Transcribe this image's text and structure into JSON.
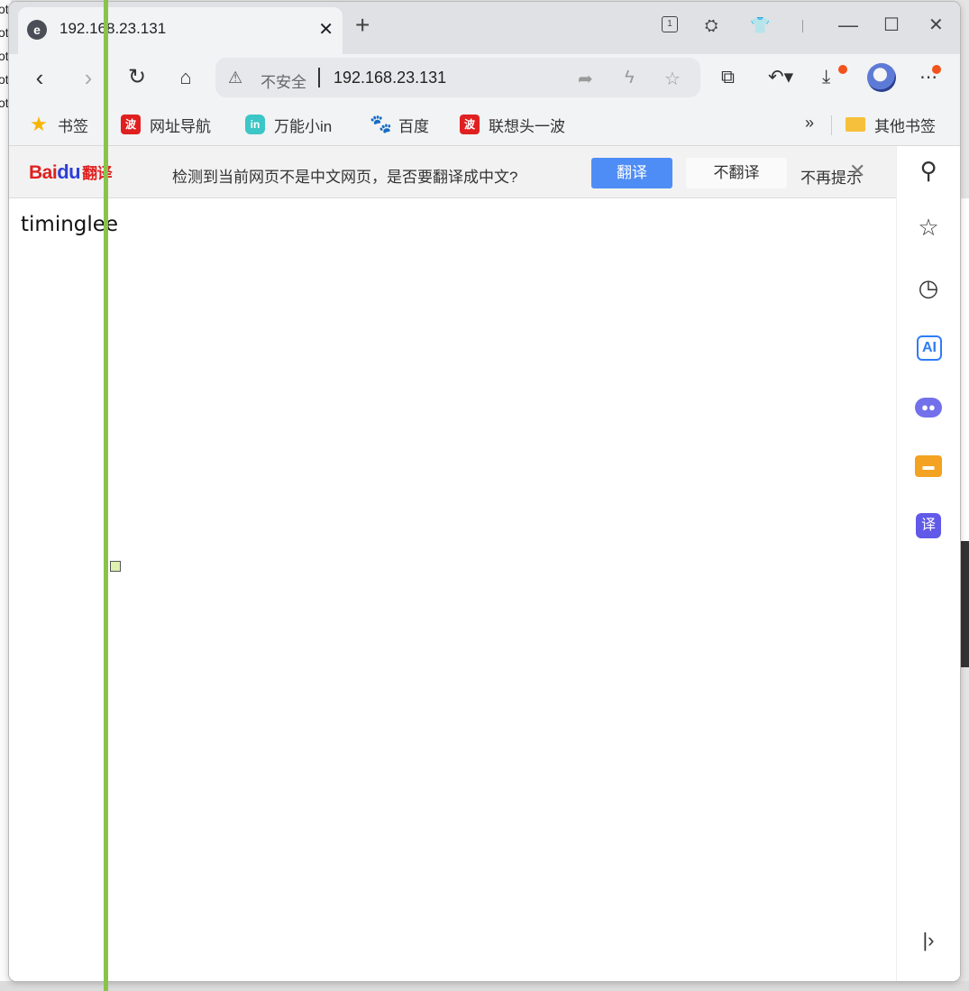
{
  "background": {
    "left_fragments": [
      "ot",
      "ot",
      "ot",
      "ot",
      "ot"
    ]
  },
  "tab": {
    "title": "192.168.23.131",
    "favicon": "browser-e-icon",
    "close_icon": "close-icon"
  },
  "toolbar": {
    "tab_count": "1",
    "security_label": "不安全",
    "url": "192.168.23.131"
  },
  "bookmarks": {
    "items": [
      {
        "label": "书签",
        "icon": "star-icon"
      },
      {
        "label": "网址导航",
        "icon": "hao123-icon"
      },
      {
        "label": "万能小in",
        "icon": "wanneng-icon"
      },
      {
        "label": "百度",
        "icon": "baidu-paw-icon"
      },
      {
        "label": "联想头一波",
        "icon": "lenovo-icon"
      }
    ],
    "more": "»",
    "other": "其他书签"
  },
  "translate_bar": {
    "logo_text": "Bai",
    "logo_du": "du",
    "logo_suffix": "翻译",
    "message": "检测到当前网页不是中文网页，是否要翻译成中文?",
    "translate_button": "翻译",
    "no_translate_button": "不翻译",
    "never_remind": "不再提示"
  },
  "page": {
    "text": "timinglee"
  },
  "colors": {
    "accent_blue": "#4e8df5",
    "tab_bar": "#dfe1e5",
    "toolbar": "#f1f3f4",
    "overlay_green": "#8bc34a",
    "notification_dot": "#f2521b"
  }
}
